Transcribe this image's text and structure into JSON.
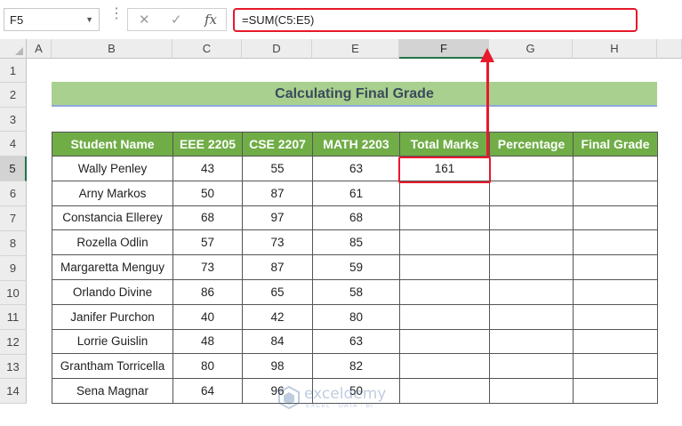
{
  "formula_bar": {
    "name_box": "F5",
    "cancel_icon": "✕",
    "enter_icon": "✓",
    "function_icon": "fx",
    "formula": "=SUM(C5:E5)"
  },
  "columns": [
    "A",
    "B",
    "C",
    "D",
    "E",
    "F",
    "G",
    "H"
  ],
  "rows": [
    "1",
    "2",
    "3",
    "4",
    "5",
    "6",
    "7",
    "8",
    "9",
    "10",
    "11",
    "12",
    "13",
    "14"
  ],
  "sheet": {
    "title": "Calculating Final Grade",
    "headers": [
      "Student Name",
      "EEE 2205",
      "CSE 2207",
      "MATH 2203",
      "Total Marks",
      "Percentage",
      "Final Grade"
    ],
    "rows": [
      {
        "name": "Wally Penley",
        "eee": "43",
        "cse": "55",
        "math": "63",
        "total": "161",
        "pct": "",
        "grade": ""
      },
      {
        "name": "Arny Markos",
        "eee": "50",
        "cse": "87",
        "math": "61",
        "total": "",
        "pct": "",
        "grade": ""
      },
      {
        "name": "Constancia Ellerey",
        "eee": "68",
        "cse": "97",
        "math": "68",
        "total": "",
        "pct": "",
        "grade": ""
      },
      {
        "name": "Rozella Odlin",
        "eee": "57",
        "cse": "73",
        "math": "85",
        "total": "",
        "pct": "",
        "grade": ""
      },
      {
        "name": "Margaretta Menguy",
        "eee": "73",
        "cse": "87",
        "math": "59",
        "total": "",
        "pct": "",
        "grade": ""
      },
      {
        "name": "Orlando Divine",
        "eee": "86",
        "cse": "65",
        "math": "58",
        "total": "",
        "pct": "",
        "grade": ""
      },
      {
        "name": "Janifer Purchon",
        "eee": "40",
        "cse": "42",
        "math": "80",
        "total": "",
        "pct": "",
        "grade": ""
      },
      {
        "name": "Lorrie Guislin",
        "eee": "48",
        "cse": "84",
        "math": "63",
        "total": "",
        "pct": "",
        "grade": ""
      },
      {
        "name": "Grantham Torricella",
        "eee": "80",
        "cse": "98",
        "math": "82",
        "total": "",
        "pct": "",
        "grade": ""
      },
      {
        "name": "Sena Magnar",
        "eee": "64",
        "cse": "96",
        "math": "50",
        "total": "",
        "pct": "",
        "grade": ""
      }
    ]
  },
  "watermark": {
    "name": "exceldemy",
    "tagline": "EXCEL · DATA · BI"
  },
  "colors": {
    "header_green": "#70ad47",
    "title_green": "#a9d08e",
    "highlight_red": "#e8192c"
  }
}
